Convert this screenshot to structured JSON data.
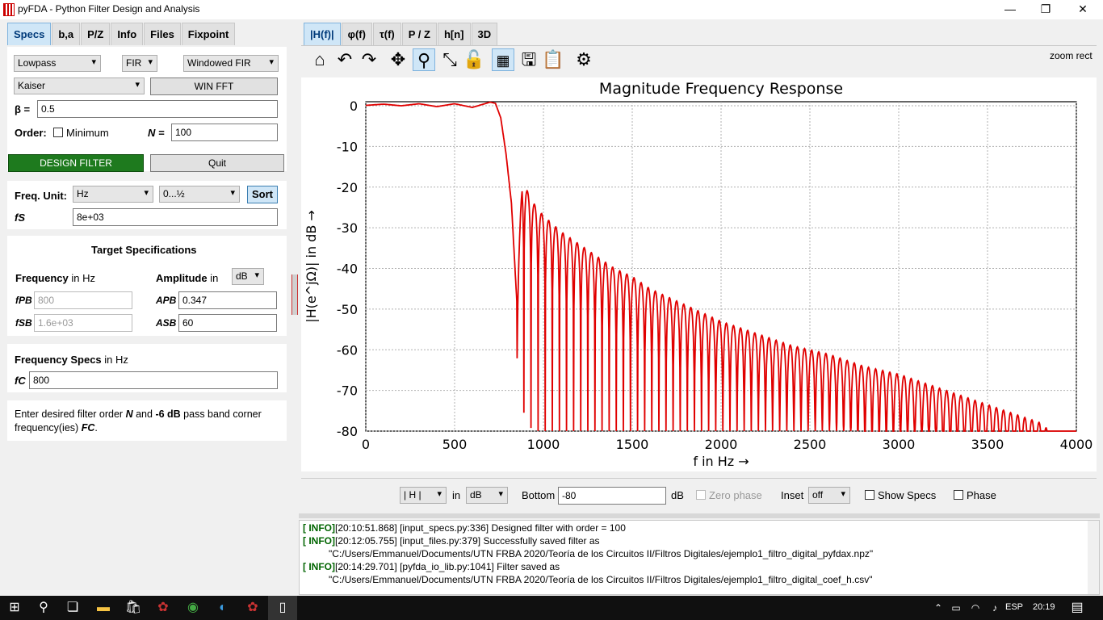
{
  "window": {
    "title": "pyFDA - Python Filter Design and Analysis",
    "minimize": "—",
    "restore": "❐",
    "close": "✕"
  },
  "left_tabs": [
    "Specs",
    "b,a",
    "P/Z",
    "Info",
    "Files",
    "Fixpoint"
  ],
  "filter": {
    "response_type": "Lowpass",
    "filter_type": "FIR",
    "design_method": "Windowed FIR",
    "window": "Kaiser",
    "win_fft_label": "WIN FFT",
    "beta_label": "β =",
    "beta_value": "0.5",
    "order_label": "Order:",
    "minimum_label": "Minimum",
    "n_label": "N =",
    "n_value": "100",
    "design_label": "DESIGN FILTER",
    "quit_label": "Quit"
  },
  "freq": {
    "unit_label": "Freq. Unit:",
    "unit": "Hz",
    "range": "0...½",
    "sort_label": "Sort",
    "fs_label": "fS",
    "fs_value": "8e+03"
  },
  "target": {
    "heading": "Target Specifications",
    "freq_label": "Frequency",
    "freq_in": "in Hz",
    "amp_label": "Amplitude",
    "amp_in": "in",
    "amp_unit": "dB",
    "fpb_label": "fPB",
    "fpb_value": "800",
    "fsb_label": "fSB",
    "fsb_value": "1.6e+03",
    "apb_label": "APB",
    "apb_value": "0.347",
    "asb_label": "ASB",
    "asb_value": "60"
  },
  "freq_specs": {
    "heading": "Frequency Specs",
    "heading_in": "in Hz",
    "fc_label": "fC",
    "fc_value": "800"
  },
  "help": {
    "p1": "Enter desired filter order",
    "n": "N",
    "p2": "and",
    "db": "-6 dB",
    "p3": "pass band corner frequency(ies)",
    "fc": "FC",
    "p4": "."
  },
  "right_tabs": [
    "|H(f)|",
    "φ(f)",
    "τ(f)",
    "P / Z",
    "h[n]",
    "3D"
  ],
  "toolbar": {
    "icons": [
      "home-icon",
      "undo-icon",
      "redo-icon",
      "pan-icon",
      "zoom-icon",
      "fullscreen-icon",
      "lock-icon",
      "grid-icon",
      "save-icon",
      "clipboard-icon",
      "settings-icon"
    ],
    "zoom_mode": "zoom rect"
  },
  "chart_data": {
    "type": "line",
    "title": "Magnitude Frequency Response",
    "xlabel": "f in Hz →",
    "ylabel": "|H(e^jΩ)| in dB →",
    "xlim": [
      0,
      4000
    ],
    "ylim": [
      -80,
      1
    ],
    "xticks": [
      0,
      500,
      1000,
      1500,
      2000,
      2500,
      3000,
      3500,
      4000
    ],
    "yticks": [
      0,
      -10,
      -20,
      -30,
      -40,
      -50,
      -60,
      -70,
      -80
    ],
    "grid": true,
    "color": "#e00000",
    "series": [
      {
        "passband_edge_hz": 760,
        "first_null_hz": 850,
        "sidelobe_spacing_hz": 40,
        "points": [
          [
            0,
            0.1
          ],
          [
            100,
            0.4
          ],
          [
            200,
            0.0
          ],
          [
            300,
            0.5
          ],
          [
            400,
            -0.2
          ],
          [
            500,
            0.5
          ],
          [
            600,
            -0.4
          ],
          [
            700,
            0.9
          ],
          [
            730,
            0.6
          ],
          [
            760,
            -3
          ],
          [
            790,
            -12
          ],
          [
            820,
            -24
          ],
          [
            850,
            -48
          ],
          [
            880,
            -18
          ],
          [
            920,
            -22
          ],
          [
            960,
            -25
          ],
          [
            1000,
            -27
          ],
          [
            1100,
            -31
          ],
          [
            1200,
            -34
          ],
          [
            1300,
            -37
          ],
          [
            1400,
            -40
          ],
          [
            1500,
            -42
          ],
          [
            1600,
            -45
          ],
          [
            1700,
            -47
          ],
          [
            1800,
            -49
          ],
          [
            1900,
            -51
          ],
          [
            2000,
            -53
          ],
          [
            2200,
            -56
          ],
          [
            2400,
            -59
          ],
          [
            2600,
            -61
          ],
          [
            2800,
            -64
          ],
          [
            3000,
            -66
          ],
          [
            3200,
            -69
          ],
          [
            3400,
            -72
          ],
          [
            3600,
            -75
          ],
          [
            3800,
            -78
          ],
          [
            3850,
            -80
          ],
          [
            4000,
            -80
          ]
        ]
      }
    ]
  },
  "bottom": {
    "mag_mode": "| H |",
    "in_label": "in",
    "unit": "dB",
    "bottom_label": "Bottom",
    "bottom_value": "-80",
    "bottom_unit": "dB",
    "zero_phase_label": "Zero phase",
    "inset_label": "Inset",
    "inset_value": "off",
    "show_specs_label": "Show Specs",
    "phase_label": "Phase"
  },
  "log": [
    {
      "tag": "[ INFO]",
      "text": "[20:10:51.868] [input_specs.py:336] Designed filter with order = 100"
    },
    {
      "tag": "[ INFO]",
      "text": "[20:12:05.755] [input_files.py:379] Successfully saved filter as"
    },
    {
      "tag": "",
      "text": "\"C:/Users/Emmanuel/Documents/UTN FRBA 2020/Teoría de los Circuitos II/Filtros Digitales/ejemplo1_filtro_digital_pyfdax.npz\""
    },
    {
      "tag": "[ INFO]",
      "text": "[20:14:29.701] [pyfda_io_lib.py:1041] Filter saved as"
    },
    {
      "tag": "",
      "text": "\"C:/Users/Emmanuel/Documents/UTN FRBA 2020/Teoría de los Circuitos II/Filtros Digitales/ejemplo1_filtro_digital_coef_h.csv\""
    }
  ],
  "taskbar": {
    "lang": "ESP",
    "time": "20:19"
  }
}
